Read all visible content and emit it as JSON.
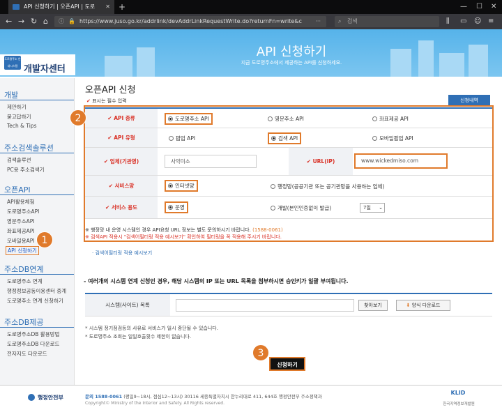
{
  "browser": {
    "tab_title": "API 신청하기 | 오픈API | 도로",
    "url": "https://www.juso.go.kr/addrlink/devAddrLinkRequestWrite.do?returnFn=write&c",
    "search_placeholder": "검색"
  },
  "banner": {
    "title": "API 신청하기",
    "subtitle": "지금 도로명주소에서 제공하는 API를 신청하세요.",
    "logo_small": "도로명주소 안내시스템",
    "logo_text": "개발자센터"
  },
  "sidebar": {
    "sections": [
      {
        "title": "개발",
        "items": [
          "제안하기",
          "묻고답하기",
          "Tech & Tips"
        ]
      },
      {
        "title": "주소검색솔루션",
        "items": [
          "검색솔루션",
          "PC용 주소검색기"
        ]
      },
      {
        "title": "오픈API",
        "items": [
          "API활용체험",
          "도로명주소API",
          "영문주소API",
          "좌표제공API",
          "모바일용API",
          "API 신청하기"
        ]
      },
      {
        "title": "주소DB연계",
        "items": [
          "도로명주소 연계",
          "행정정보공동이용센터 중계",
          "도로명주소 연계 신청하기"
        ]
      },
      {
        "title": "주소DB제공",
        "items": [
          "도로명주소DB 활용방법",
          "도로명주소DB 다운로드",
          "전자지도 다운로드"
        ]
      }
    ]
  },
  "main": {
    "title": "오픈API 신청",
    "required_note": "표시는 필수 입력",
    "required_mark": "✔",
    "history_button": "신청내역",
    "rows": {
      "api_type": {
        "label": "API 종류",
        "options": [
          "도로명주소 API",
          "영문주소 API",
          "좌표제공 API"
        ],
        "selected": "도로명주소 API"
      },
      "api_kind": {
        "label": "API 유형",
        "options": [
          "팝업 API",
          "검색 API",
          "모바일팝업 API"
        ],
        "selected": "검색 API"
      },
      "company": {
        "label": "업체(기관명)",
        "value": "사악미소"
      },
      "url": {
        "label": "URL(IP)",
        "value": "www.wickedmiso.com"
      },
      "service_net": {
        "label": "서비스망",
        "options": [
          "인터넷망",
          "행정망(공공기관 또는 공기관망을 사용하는 업체)"
        ],
        "selected": "인터넷망"
      },
      "service_use": {
        "label": "서비스 용도",
        "options": [
          "운영",
          "개발(본인인증없이 발급)"
        ],
        "selected": "운영",
        "period": "7일"
      }
    },
    "note1": "※ 행정망 내 운영 시스템인 경우 API요청 URL 정보는 별도 문의하시기 바랍니다.",
    "note1_phone": "(1588-0061)",
    "note2": "※ 검색API 적용시 \"검색어필터링 적용 예시보기\" 확인하여 필터링을 꼭 적용해 주시기 바랍니다.",
    "filter_link": "· 검색어필터링 적용 예시보기",
    "section2_title": "- 여러개의 시스템 연계 신청인 경우, 해당 시스템의 IP 또는 URL 목록을 첨부하시면 승인키가 일괄 부여됩니다.",
    "system_list_label": "시스템(사이트) 목록",
    "browse_button": "찾아보기",
    "template_button": "양식 다운로드",
    "bullets": [
      "* 시스템 정기점검등의 사유로 서비스가 일시 중단될 수 있습니다.",
      "* 도로명주소 조회는 일일호출횟수 제한이 없습니다."
    ],
    "submit_button": "신청하기"
  },
  "annotations": [
    "1",
    "2",
    "3"
  ],
  "footer": {
    "ministry": "행정안전부",
    "phone_label": "문의 1588-0061",
    "hours": "(평일9~18시, 점심12~13시)",
    "address": "30116 세종특별자치시 한누리대로 411, 644호 행정안전부 주소정책과",
    "copyright": "Copyright© Ministry of the Interior and Safety. All Rights reserved.",
    "klid": "KLID",
    "klid_sub": "한국지역정보개발원"
  },
  "colors": {
    "accent": "#2f6fb5",
    "highlight": "#e07a2b",
    "required": "#d93025"
  }
}
